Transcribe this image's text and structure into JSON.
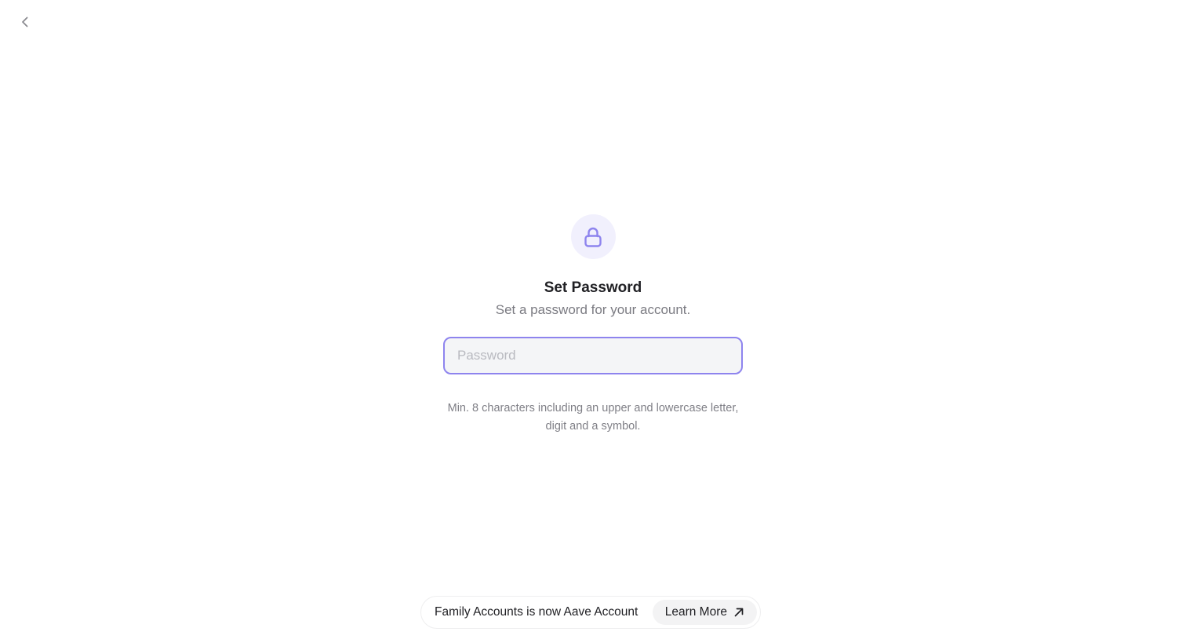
{
  "nav": {
    "back_icon": "chevron-left-icon"
  },
  "header": {
    "icon": "lock-icon",
    "icon_bg_color": "#f1f0fd",
    "icon_color": "#8e84ee",
    "title": "Set Password",
    "subtitle": "Set a password for your account."
  },
  "form": {
    "password": {
      "value": "",
      "placeholder": "Password",
      "focus_color": "#8e84ee"
    },
    "hint": "Min. 8 characters including an upper and lowercase letter, digit and a symbol."
  },
  "banner": {
    "text": "Family Accounts is now Aave Account",
    "cta_label": "Learn More",
    "cta_icon": "arrow-up-right-icon"
  }
}
